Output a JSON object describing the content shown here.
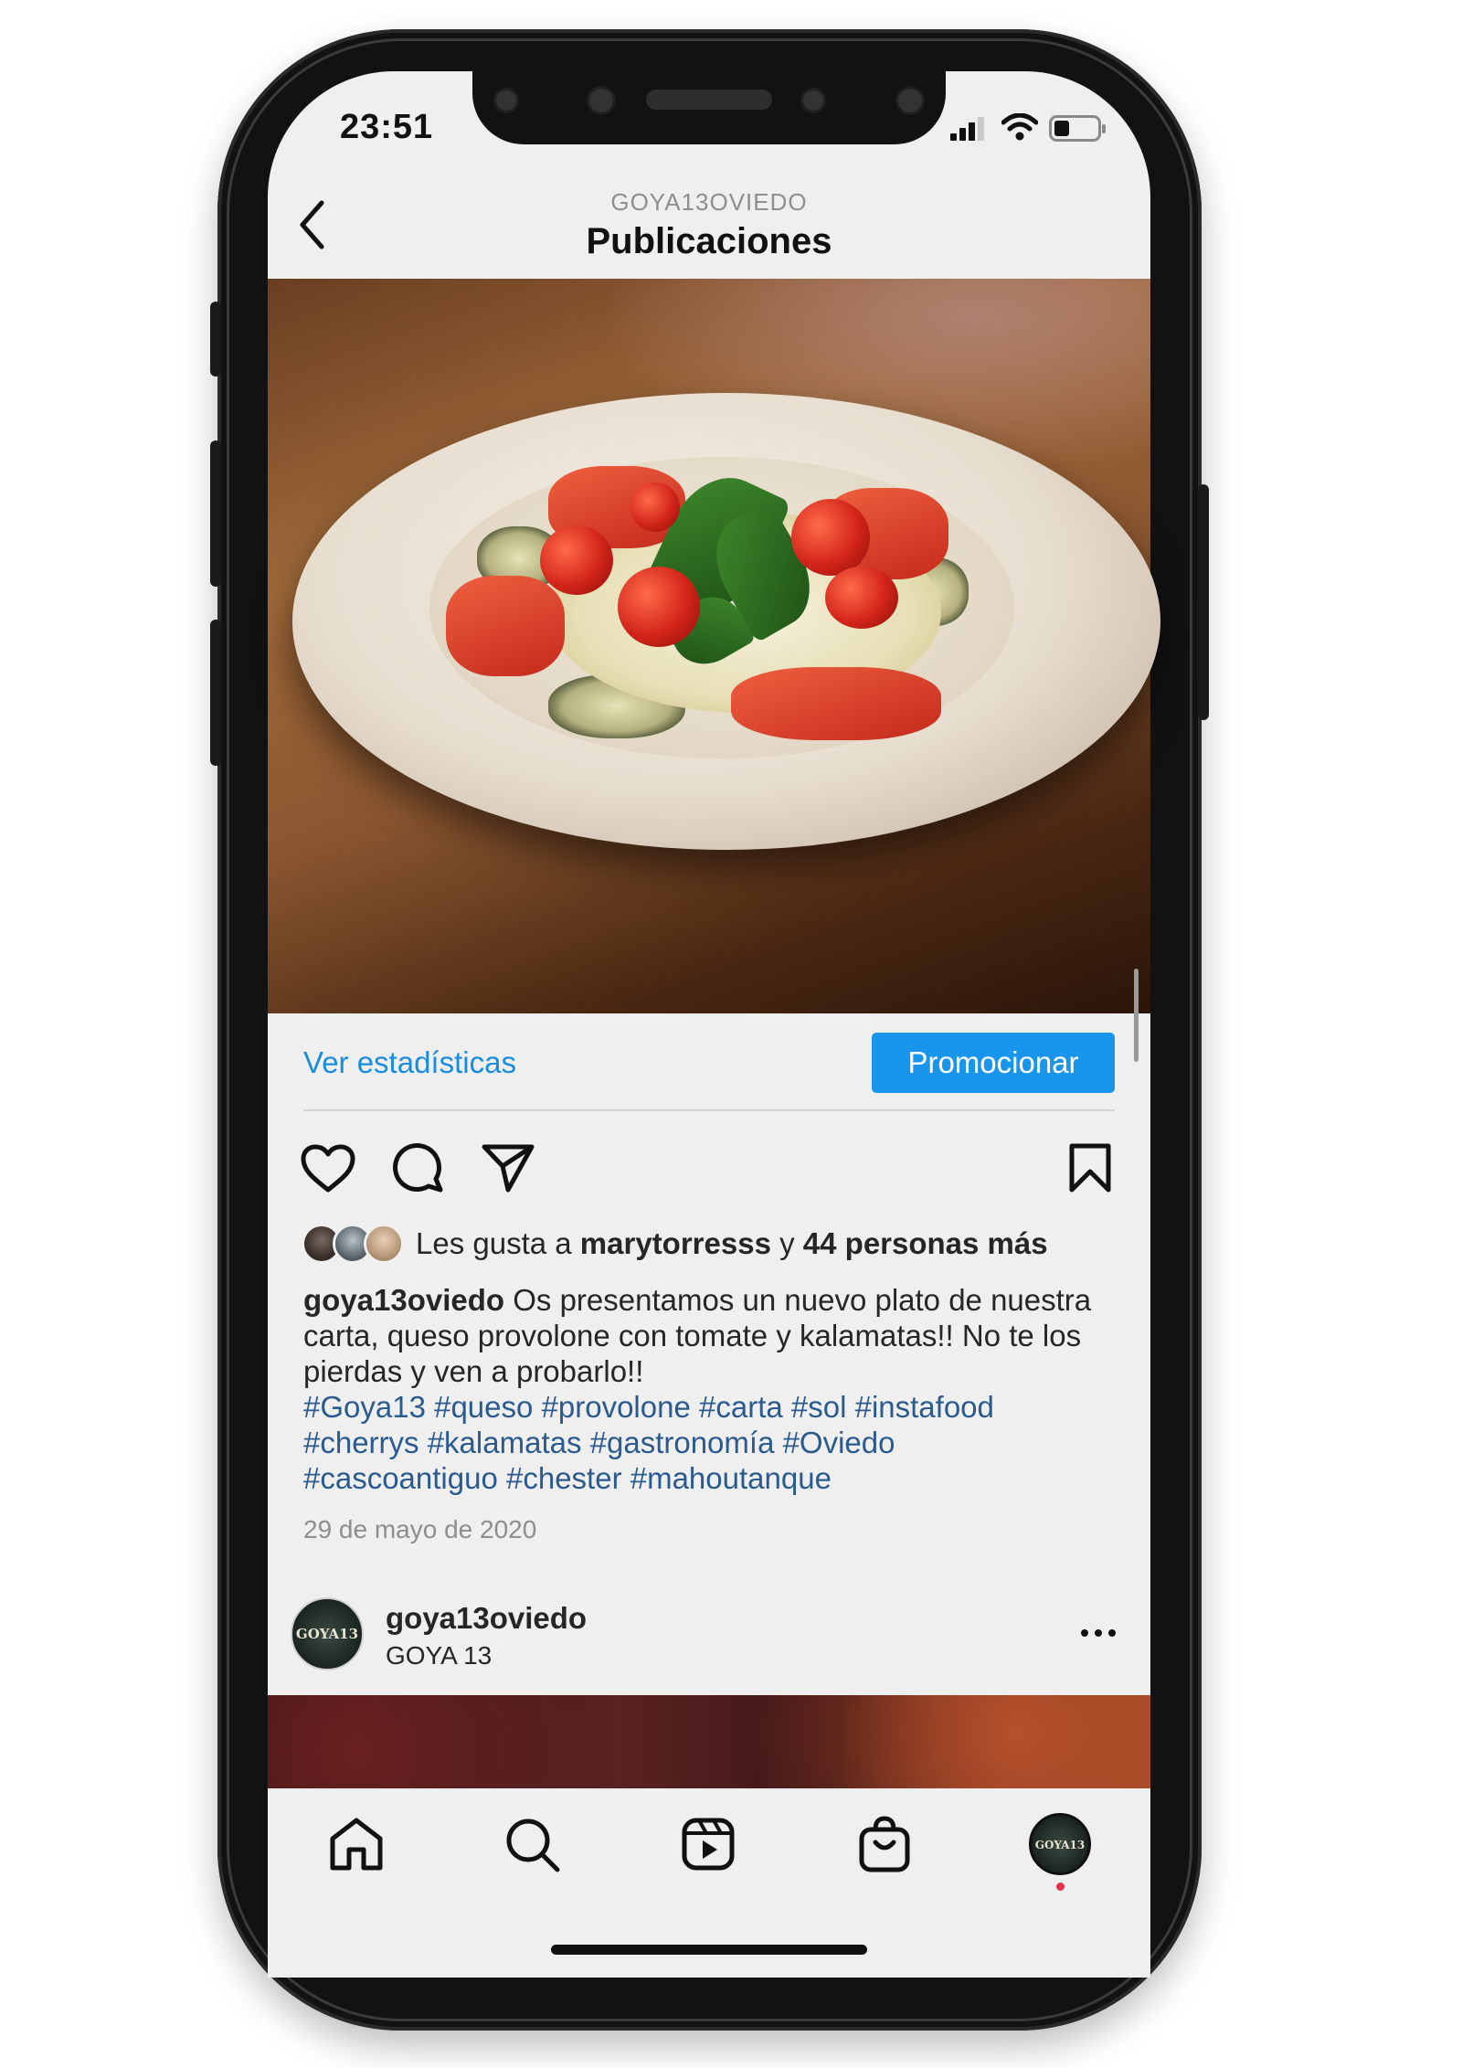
{
  "status_bar": {
    "time": "23:51"
  },
  "header": {
    "account": "GOYA13OVIEDO",
    "title": "Publicaciones"
  },
  "post": {
    "insights_label": "Ver estadísticas",
    "promote_label": "Promocionar",
    "likes": {
      "prefix": "Les gusta a ",
      "user": "marytorresss",
      "middle": " y ",
      "others": "44 personas más"
    },
    "caption": {
      "username": "goya13oviedo",
      "text": " Os presentamos un nuevo plato de nuestra carta, queso provolone con tomate y kalamatas!! No te los pierdas y ven a probarlo!!",
      "hashtags": "#Goya13 #queso #provolone #carta #sol #instafood #cherrys #kalamatas #gastronomía #Oviedo #cascoantiguo #chester #mahoutanque"
    },
    "date": "29 de mayo de 2020"
  },
  "next_post": {
    "username": "goya13oviedo",
    "location": "GOYA 13",
    "avatar_text": "GOYA13"
  },
  "nav": {
    "profile_avatar_text": "GOYA13"
  },
  "colors": {
    "accent_blue": "#1a95ec",
    "link_blue": "#1a8cde",
    "hashtag_blue": "#2b5a8e",
    "notification_dot": "#e8304b"
  }
}
